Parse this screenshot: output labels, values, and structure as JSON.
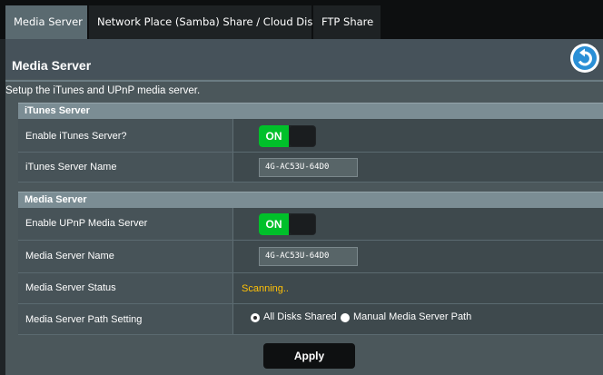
{
  "tabs": [
    {
      "label": "Media Server",
      "active": true
    },
    {
      "label": "Network Place (Samba) Share / Cloud Disk",
      "active": false
    },
    {
      "label": "FTP Share",
      "active": false
    }
  ],
  "page_title": "Media Server",
  "back_icon": "back-arrow-icon",
  "description": "Setup the iTunes and UPnP media server.",
  "itunes_section": {
    "title": "iTunes Server",
    "enable_label": "Enable iTunes Server?",
    "enable_value": "ON",
    "name_label": "iTunes Server Name",
    "name_value": "4G-AC53U-64D0"
  },
  "media_section": {
    "title": "Media Server",
    "enable_label": "Enable UPnP Media Server",
    "enable_value": "ON",
    "name_label": "Media Server Name",
    "name_value": "4G-AC53U-64D0",
    "status_label": "Media Server Status",
    "status_value": "Scanning..",
    "path_label": "Media Server Path Setting",
    "path_options": [
      "All Disks Shared",
      "Manual Media Server Path"
    ],
    "path_selected": "All Disks Shared"
  },
  "apply_label": "Apply",
  "colors": {
    "toggle_on": "#00c02a",
    "status": "#ffc107",
    "accent": "#2a8fd6"
  }
}
